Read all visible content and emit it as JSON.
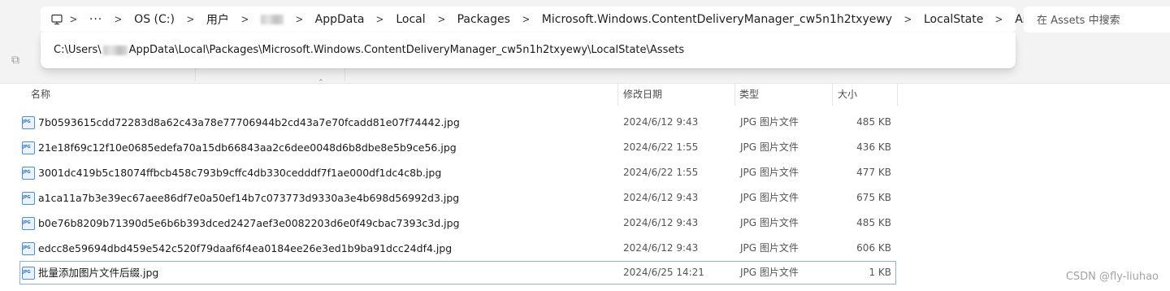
{
  "breadcrumb": {
    "items": [
      "OS (C:)",
      "用户",
      "AppData",
      "Local",
      "Packages",
      "Microsoft.Windows.ContentDeliveryManager_cw5n1h2txyewy",
      "LocalState",
      "Assets"
    ]
  },
  "path_popup": {
    "before": "C:\\Users\\",
    "after": "AppData\\Local\\Packages\\Microsoft.Windows.ContentDeliveryManager_cw5n1h2txyewy\\LocalState\\Assets"
  },
  "search": {
    "placeholder": "在 Assets 中搜索"
  },
  "columns": {
    "name": "名称",
    "date": "修改日期",
    "type": "类型",
    "size": "大小"
  },
  "files": [
    {
      "name": "7b0593615cdd72283d8a62c43a78e77706944b2cd43a7e70fcadd81e07f74442.jpg",
      "date": "2024/6/12 9:43",
      "type": "JPG 图片文件",
      "size": "485 KB"
    },
    {
      "name": "21e18f69c12f10e0685edefa70a15db66843aa2c6dee0048d6b8dbe8e5b9ce56.jpg",
      "date": "2024/6/22 1:55",
      "type": "JPG 图片文件",
      "size": "436 KB"
    },
    {
      "name": "3001dc419b5c18074ffbcb458c793b9cffc4db330cedddf7f1ae000df1dc4c8b.jpg",
      "date": "2024/6/22 1:55",
      "type": "JPG 图片文件",
      "size": "477 KB"
    },
    {
      "name": "a1ca11a7b3e39ec67aee86df7e0a50ef14b7c073773d9330a3e4b698d56992d3.jpg",
      "date": "2024/6/12 9:43",
      "type": "JPG 图片文件",
      "size": "675 KB"
    },
    {
      "name": "b0e76b8209b71390d5e6b6b393dced2427aef3e0082203d6e0f49cbac7393c3d.jpg",
      "date": "2024/6/12 9:43",
      "type": "JPG 图片文件",
      "size": "485 KB"
    },
    {
      "name": "edcc8e59694dbd459e542c520f79daaf6f4ea0184ee26e3ed1b9ba91dcc24df4.jpg",
      "date": "2024/6/12 9:43",
      "type": "JPG 图片文件",
      "size": "606 KB"
    },
    {
      "name": "批量添加图片文件后缀.jpg",
      "date": "2024/6/25 14:21",
      "type": "JPG 图片文件",
      "size": "1 KB"
    }
  ],
  "watermark": "CSDN @fly-liuhao",
  "colors": {
    "focus_border": "#90b4d6",
    "file_icon": "#4d8fd8"
  }
}
